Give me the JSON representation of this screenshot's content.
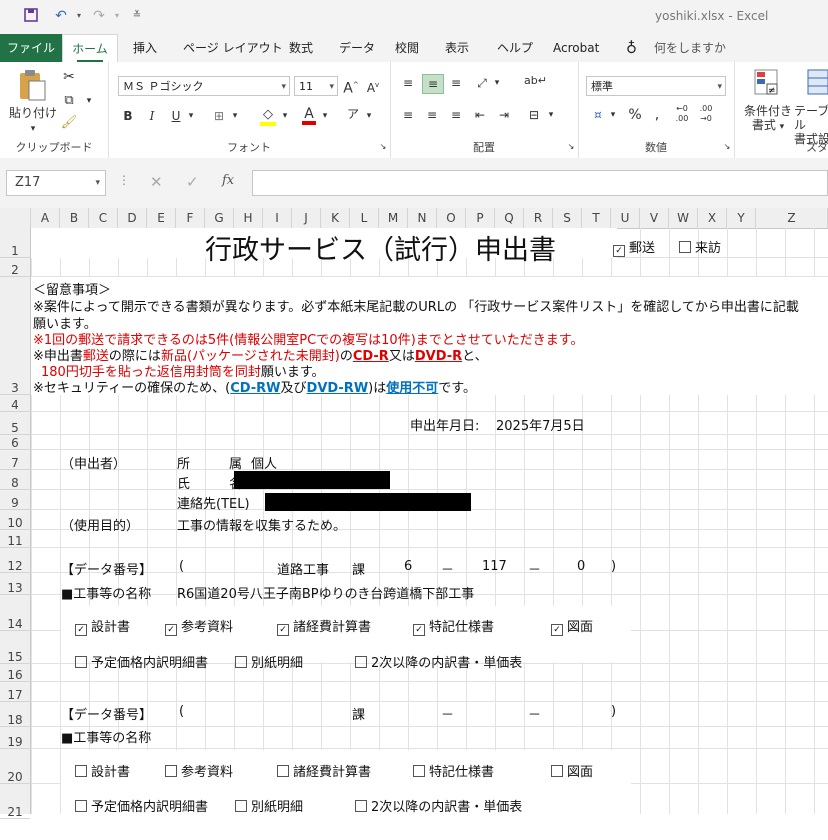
{
  "titlebar": {
    "filename": "yoshiki.xlsx",
    "app": "Excel"
  },
  "tabs": [
    "ファイル",
    "ホーム",
    "挿入",
    "ページ レイアウト",
    "数式",
    "データ",
    "校閲",
    "表示",
    "ヘルプ",
    "Acrobat"
  ],
  "tell_me": "何をしますか",
  "ribbon": {
    "paste_label": "貼り付け",
    "clipboard_label": "クリップボード",
    "font_name": "ＭＳ Ｐゴシック",
    "font_size": "11",
    "font_label": "フォント",
    "align_label": "配置",
    "number_format": "標準",
    "number_label": "数値",
    "cond_format_line1": "条件付き",
    "cond_format_line2": "書式",
    "table_line1": "テーブル",
    "table_line2": "書式設",
    "styles_label": "スタ"
  },
  "formula_bar": {
    "name_box": "Z17",
    "fx": "fx",
    "value": ""
  },
  "columns": [
    "A",
    "B",
    "C",
    "D",
    "E",
    "F",
    "G",
    "H",
    "I",
    "J",
    "K",
    "L",
    "M",
    "N",
    "O",
    "P",
    "Q",
    "R",
    "S",
    "T",
    "U",
    "V",
    "W",
    "X",
    "Y",
    "Z"
  ],
  "rows": [
    "1",
    "2",
    "3",
    "4",
    "5",
    "6",
    "7",
    "8",
    "9",
    "10",
    "11",
    "12",
    "13",
    "14",
    "15",
    "16",
    "17",
    "18",
    "19",
    "20",
    "21"
  ],
  "sheet": {
    "title": "行政サービス（試行）申出書",
    "opt_mail": "郵送",
    "opt_visit": "来訪",
    "notes_header": "＜留意事項＞",
    "note1a": "※案件によって開示できる書類が異なります。必ず本紙末尾記載のURLの 「行政サービス案件リスト」を確認してから申出書に記載",
    "note1b": "願います。",
    "note2": "※1回の郵送で請求できるのは5件(情報公開室PCでの複写は10件)までとさせていただきます。",
    "note3_pre": "※申出書",
    "note3_mail": "郵送",
    "note3_mid": "の際には",
    "note3_new": "新品(パッケージされた未開封)",
    "note3_no": "の",
    "note3_cdr": "CD-R",
    "note3_or": "又は",
    "note3_dvdr": "DVD-R",
    "note3_end": "と、",
    "note4_red": "180円切手を貼った返信用封筒を同封",
    "note4_end": "願います。",
    "note5_pre": "※セキュリティーの確保のため、(",
    "note5_cdrw": "CD-RW",
    "note5_and": "及び",
    "note5_dvdrw": "DVD-RW",
    "note5_mid": ")は",
    "note5_ng": "使用不可",
    "note5_end": "です。",
    "date_label": "申出年月日:",
    "date_value": "2025年7月5日",
    "applicant": "（申出者）",
    "address_label": "所　　　属",
    "address_value": "個人",
    "name_label": "氏　　　名",
    "tel_label": "連絡先(TEL)",
    "purpose_label": "（使用目的）",
    "purpose_value": "工事の情報を収集するため。",
    "data_no_label": "【データ番号】",
    "paren_open": "(",
    "paren_close": ")",
    "ka": "課",
    "dash": "－",
    "entry1": {
      "dept": "道路工事",
      "num1": "6",
      "num2": "117",
      "num3": "0",
      "name_label": "■工事等の名称",
      "name_value": "R6国道20号八王子南BPゆりのき台跨道橋下部工事",
      "docs": [
        {
          "label": "設計書",
          "checked": true
        },
        {
          "label": "参考資料",
          "checked": true
        },
        {
          "label": "諸経費計算書",
          "checked": true
        },
        {
          "label": "特記仕様書",
          "checked": true
        },
        {
          "label": "図面",
          "checked": true
        },
        {
          "label": "予定価格内訳明細書",
          "checked": false
        },
        {
          "label": "別紙明細",
          "checked": false
        },
        {
          "label": "2次以降の内訳書・単価表",
          "checked": false
        }
      ]
    },
    "entry2": {
      "name_label": "■工事等の名称",
      "docs": [
        {
          "label": "設計書",
          "checked": false
        },
        {
          "label": "参考資料",
          "checked": false
        },
        {
          "label": "諸経費計算書",
          "checked": false
        },
        {
          "label": "特記仕様書",
          "checked": false
        },
        {
          "label": "図面",
          "checked": false
        },
        {
          "label": "予定価格内訳明細書",
          "checked": false
        },
        {
          "label": "別紙明細",
          "checked": false
        },
        {
          "label": "2次以降の内訳書・単価表",
          "checked": false
        }
      ]
    }
  }
}
